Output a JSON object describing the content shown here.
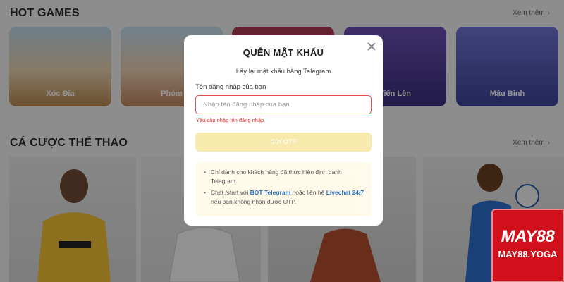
{
  "hot_games": {
    "title": "HOT GAMES",
    "see_more": "Xem thêm",
    "cards": [
      {
        "label": "Xóc Đĩa",
        "color_top": "#bfd9ec",
        "color_bottom": "#caa66f"
      },
      {
        "label": "Phỏm",
        "color_top": "#c4dff2",
        "color_bottom": "#d6a882"
      },
      {
        "label": "",
        "color_top": "#b03a56",
        "color_bottom": "#6b1d34"
      },
      {
        "label": "Tiến Lên",
        "color_top": "#6a4fb4",
        "color_bottom": "#2f2a6e"
      },
      {
        "label": "Mậu Binh",
        "color_top": "#6c6fd1",
        "color_bottom": "#3a3f95"
      }
    ]
  },
  "sports": {
    "title": "CÁ CƯỢC THỂ THAO",
    "see_more": "Xem thêm"
  },
  "modal": {
    "title": "QUÊN MẬT KHẨU",
    "subtitle": "Lấy lại mật khẩu bằng Telegram",
    "field_label": "Tên đăng nhập của bạn",
    "input_placeholder": "Nhập tên đăng nhập của bạn",
    "input_value": "",
    "error": "Yêu cầu nhập tên đăng nhập",
    "otp_button": "Gửi OTP",
    "info_1": "Chỉ dành cho khách hàng đã thực hiện định danh Telegram.",
    "info_2_prefix": "Chat /start với",
    "info_2_bot": "BOT Telegram",
    "info_2_mid": "hoặc liên hệ",
    "info_2_livechat": "Livechat 24/7",
    "info_2_suffix": "nếu bạn không nhận được OTP."
  },
  "brand": {
    "logo": "MAY88",
    "site": "MAY88.YOGA"
  },
  "icons": {
    "close": "close-icon",
    "see_more_chevron": "chevron-right-icon"
  }
}
